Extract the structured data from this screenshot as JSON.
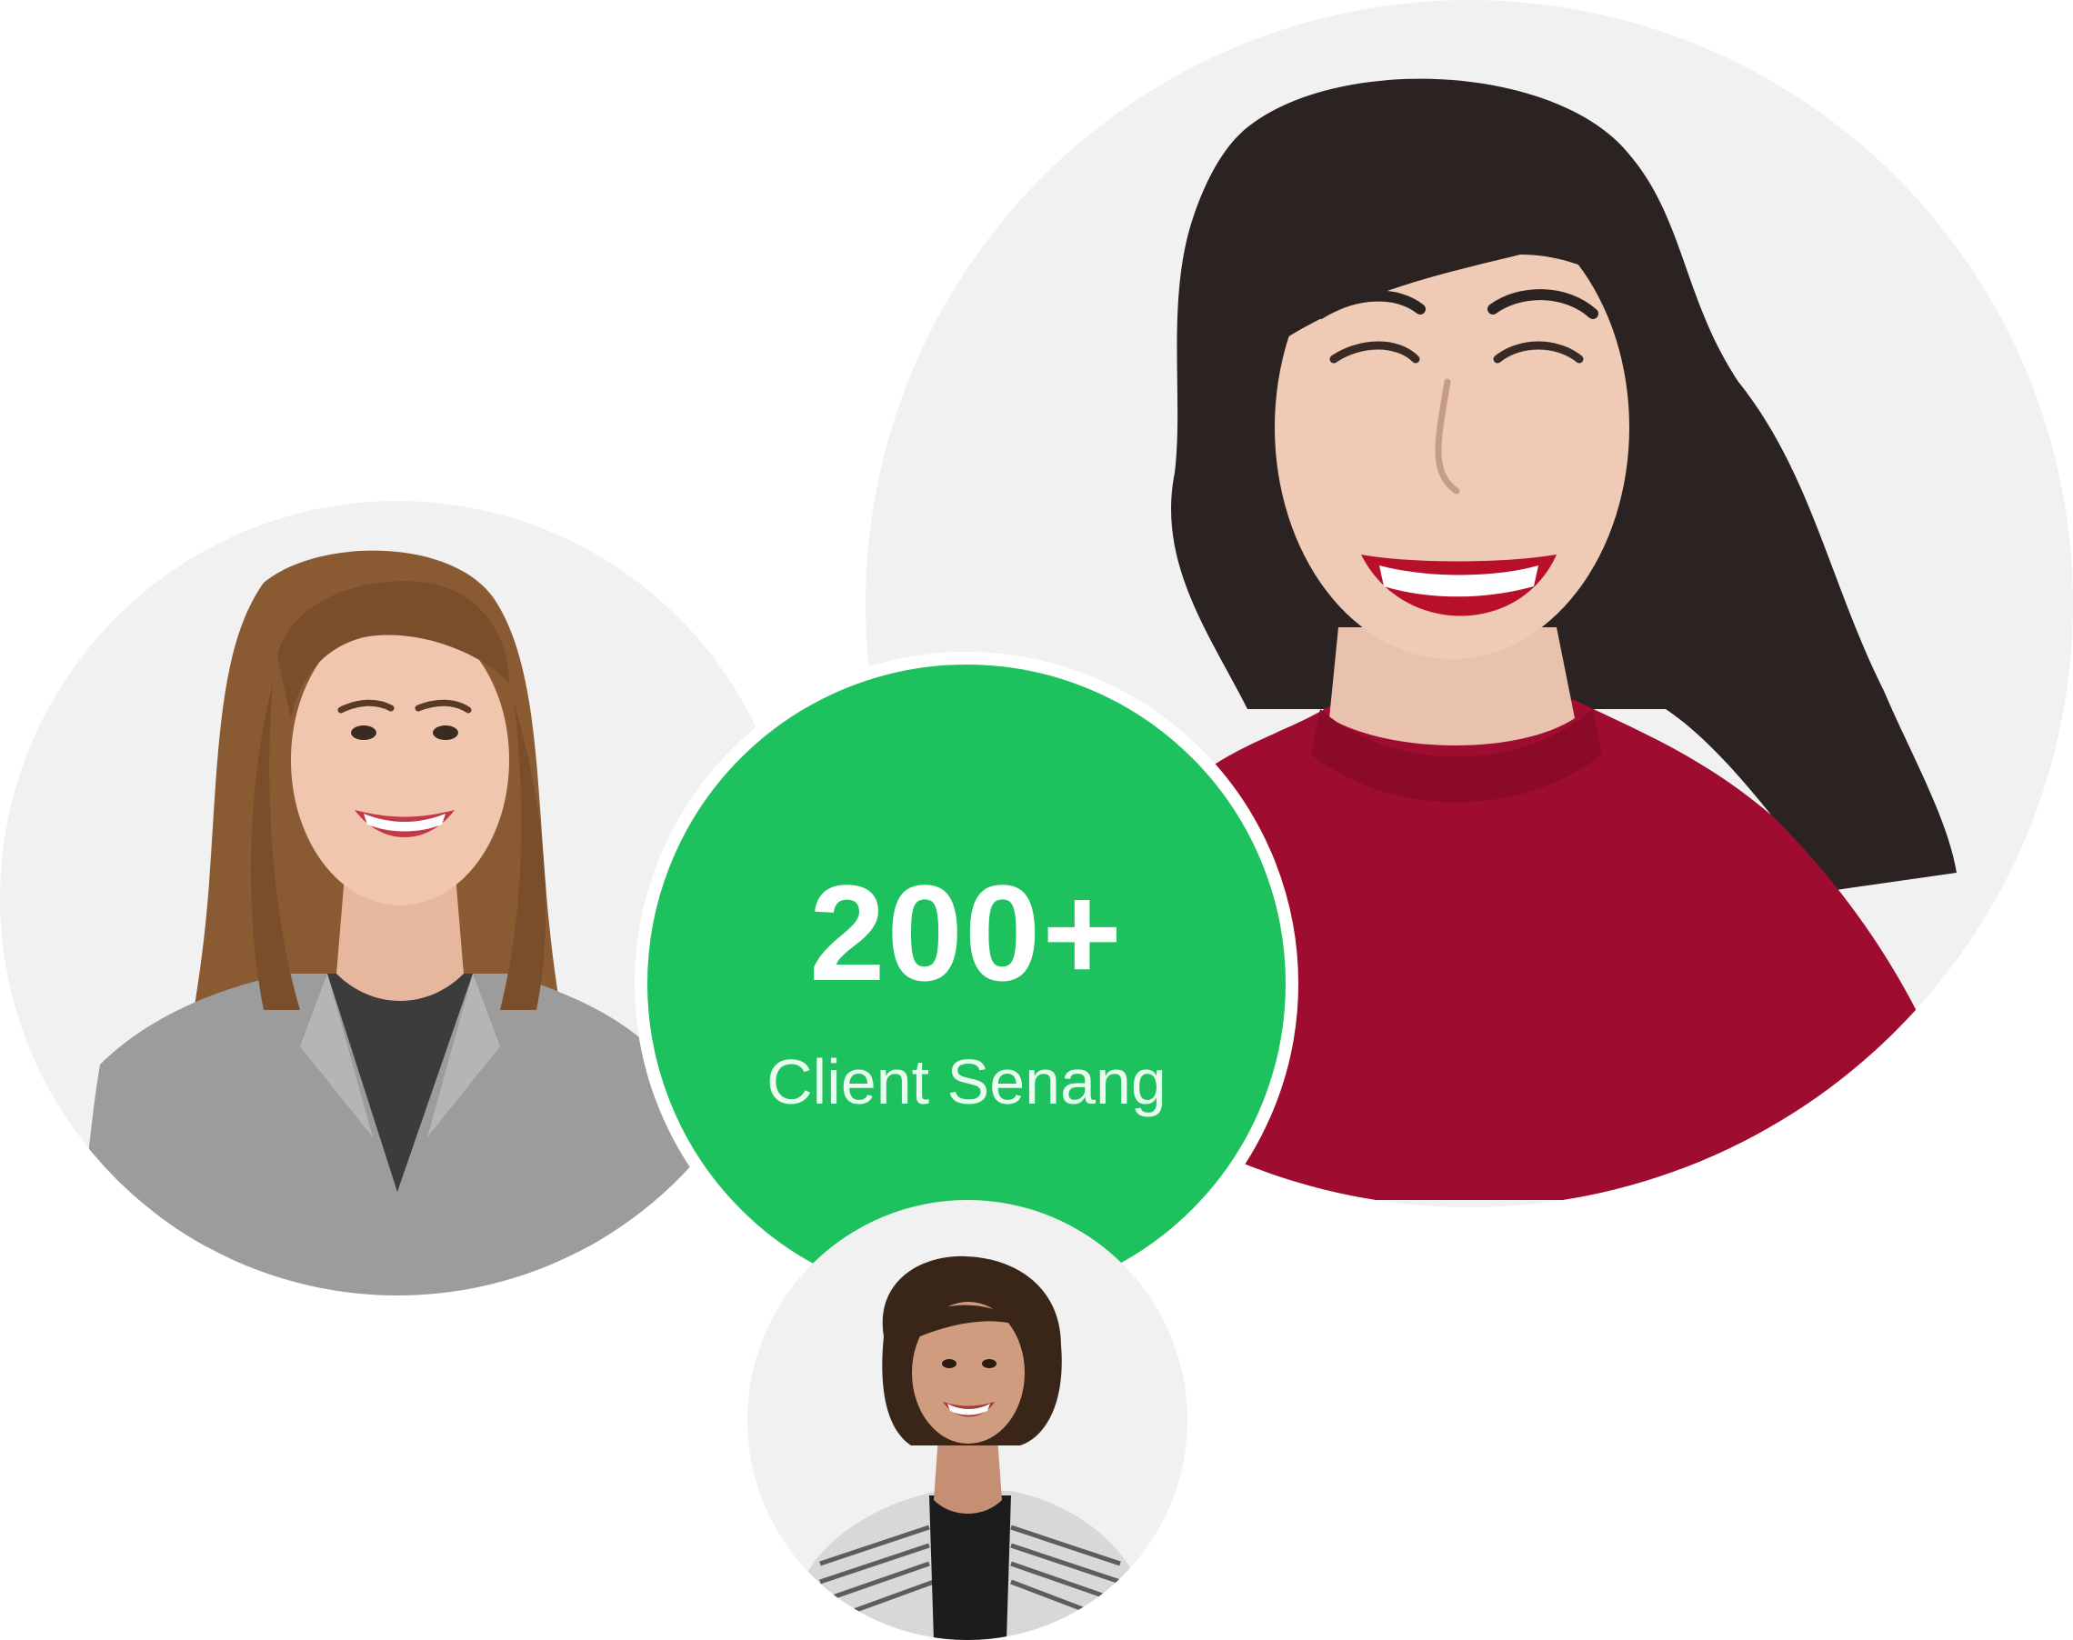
{
  "stats": {
    "number": "200+",
    "label": "Client Senang"
  },
  "avatars": [
    {
      "id": "large",
      "subject": "smiling woman with dark wavy hair in red top"
    },
    {
      "id": "left",
      "subject": "smiling woman with long light-brown hair in grey blazer"
    },
    {
      "id": "bottom",
      "subject": "smiling woman with short curly hair in striped jacket"
    }
  ],
  "colors": {
    "accent_green": "#1dc25e",
    "circle_background": "#f1f1f1",
    "page_background": "#ffffff"
  }
}
